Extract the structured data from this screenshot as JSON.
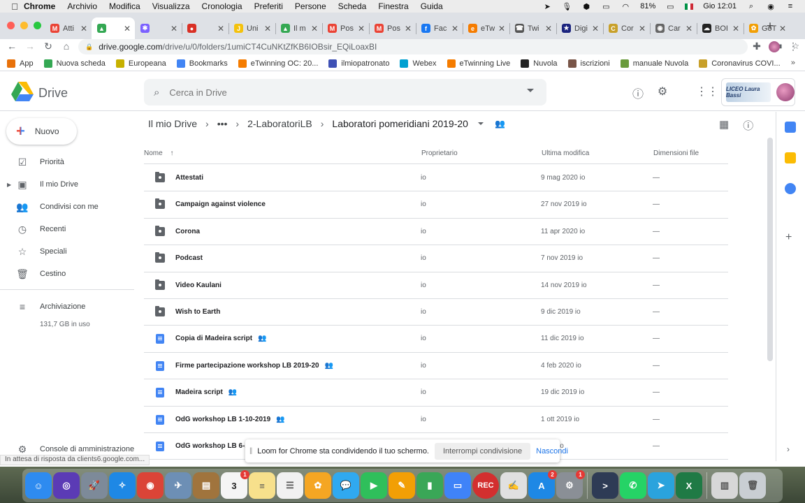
{
  "menubar": {
    "items": [
      "Chrome",
      "Archivio",
      "Modifica",
      "Visualizza",
      "Cronologia",
      "Preferiti",
      "Persone",
      "Scheda",
      "Finestra",
      "Guida"
    ],
    "battery": "81%",
    "clock": "Gio 12:01"
  },
  "tabs": [
    {
      "label": "Atti",
      "fav_color": "#ea4335",
      "fav": "M"
    },
    {
      "label": "",
      "fav_color": "#34a853",
      "fav": "▲",
      "active": true
    },
    {
      "label": "",
      "fav_color": "#7b61ff",
      "fav": "✱"
    },
    {
      "label": "",
      "fav_color": "#d93025",
      "fav": "●"
    },
    {
      "label": "Uni",
      "fav_color": "#f4c20d",
      "fav": "J"
    },
    {
      "label": "Il m",
      "fav_color": "#34a853",
      "fav": "▲"
    },
    {
      "label": "Pos",
      "fav_color": "#ea4335",
      "fav": "M"
    },
    {
      "label": "Pos",
      "fav_color": "#ea4335",
      "fav": "M"
    },
    {
      "label": "Fac",
      "fav_color": "#1877f2",
      "fav": "f"
    },
    {
      "label": "eTw",
      "fav_color": "#f57c00",
      "fav": "e"
    },
    {
      "label": "Twi",
      "fav_color": "#555555",
      "fav": "☎"
    },
    {
      "label": "Digi",
      "fav_color": "#1a237e",
      "fav": "★"
    },
    {
      "label": "Cor",
      "fav_color": "#c8a02a",
      "fav": "C"
    },
    {
      "label": "Car",
      "fav_color": "#666666",
      "fav": "◉"
    },
    {
      "label": "BOI",
      "fav_color": "#222222",
      "fav": "☁"
    },
    {
      "label": "GoT",
      "fav_color": "#f29f05",
      "fav": "✿"
    }
  ],
  "omnibox": {
    "host": "drive.google.com",
    "path": "/drive/u/0/folders/1umiCT4CuNKtZfKB6IOBsir_EQiLoaxBI"
  },
  "bookmarks": [
    {
      "label": "App",
      "color": "#e8710a"
    },
    {
      "label": "Nuova scheda",
      "color": "#34a853"
    },
    {
      "label": "Europeana",
      "color": "#c7b100"
    },
    {
      "label": "Bookmarks",
      "color": "#4285f4"
    },
    {
      "label": "eTwinning OC: 20...",
      "color": "#f57c00"
    },
    {
      "label": "ilmiopatronato",
      "color": "#3f51b5"
    },
    {
      "label": "Webex",
      "color": "#00a0d1"
    },
    {
      "label": "eTwinning Live",
      "color": "#f57c00"
    },
    {
      "label": "Nuvola",
      "color": "#222222"
    },
    {
      "label": "iscrizioni",
      "color": "#795548"
    },
    {
      "label": "manuale Nuvola",
      "color": "#6a9b3c"
    },
    {
      "label": "Coronavirus COVI...",
      "color": "#c8a02a"
    }
  ],
  "drive": {
    "title": "Drive",
    "search_placeholder": "Cerca in Drive",
    "account_label": "LICEO Laura Bassi"
  },
  "sidebar": {
    "new_label": "Nuovo",
    "items": [
      {
        "label": "Priorità",
        "icon": "check-icon",
        "glyph": "☑"
      },
      {
        "label": "Il mio Drive",
        "icon": "my-drive-icon",
        "glyph": "▣",
        "caret": true
      },
      {
        "label": "Condivisi con me",
        "icon": "shared-icon",
        "glyph": "👥"
      },
      {
        "label": "Recenti",
        "icon": "clock-icon",
        "glyph": "◷"
      },
      {
        "label": "Speciali",
        "icon": "star-icon",
        "glyph": "☆"
      },
      {
        "label": "Cestino",
        "icon": "trash-icon",
        "glyph": "🗑"
      }
    ],
    "storage_label": "Archiviazione",
    "storage_used": "131,7 GB in uso",
    "admin_label": "Console di amministrazione"
  },
  "breadcrumb": {
    "root": "Il mio Drive",
    "more": "•••",
    "parent": "2-LaboratoriLB",
    "current": "Laboratori pomeridiani 2019-20"
  },
  "table": {
    "col_name": "Nome",
    "col_owner": "Proprietario",
    "col_modified": "Ultima modifica",
    "col_size": "Dimensioni file",
    "rows": [
      {
        "name": "Attestati",
        "type": "folder",
        "owner": "io",
        "modified": "9 mag 2020 io",
        "size": "—",
        "shared": false
      },
      {
        "name": "Campaign against violence",
        "type": "folder",
        "owner": "io",
        "modified": "27 nov 2019 io",
        "size": "—",
        "shared": false
      },
      {
        "name": "Corona",
        "type": "folder",
        "owner": "io",
        "modified": "11 apr 2020 io",
        "size": "—",
        "shared": false
      },
      {
        "name": "Podcast",
        "type": "folder",
        "owner": "io",
        "modified": "7 nov 2019 io",
        "size": "—",
        "shared": false
      },
      {
        "name": "Video Kaulani",
        "type": "folder",
        "owner": "io",
        "modified": "14 nov 2019 io",
        "size": "—",
        "shared": false
      },
      {
        "name": "Wish to Earth",
        "type": "folder",
        "owner": "io",
        "modified": "9 dic 2019 io",
        "size": "—",
        "shared": false
      },
      {
        "name": "Copia di Madeira script",
        "type": "doc",
        "owner": "io",
        "modified": "11 dic 2019 io",
        "size": "—",
        "shared": true
      },
      {
        "name": "Firme partecipazione workshop LB 2019-20",
        "type": "doc",
        "owner": "io",
        "modified": "4 feb 2020 io",
        "size": "—",
        "shared": true
      },
      {
        "name": "Madeira script",
        "type": "doc",
        "owner": "io",
        "modified": "19 dic 2019 io",
        "size": "—",
        "shared": true
      },
      {
        "name": "OdG workshop LB 1-10-2019",
        "type": "doc",
        "owner": "io",
        "modified": "1 ott 2019 io",
        "size": "—",
        "shared": true
      },
      {
        "name": "OdG workshop LB 6-2",
        "type": "doc",
        "owner": "io",
        "modified": "2020 io",
        "size": "—",
        "shared": false
      }
    ]
  },
  "loom": {
    "message": "Loom for Chrome sta condividendo il tuo schermo.",
    "stop_label": "Interrompi condivisione",
    "hide_label": "Nascondi"
  },
  "statusbar": "In attesa di risposta da clients6.google.com...",
  "dock": [
    {
      "name": "finder-icon",
      "color": "#2e8bf0",
      "glyph": "☺"
    },
    {
      "name": "siri-icon",
      "color": "#5b3bb5",
      "glyph": "◎"
    },
    {
      "name": "launchpad-icon",
      "color": "#7d8a99",
      "glyph": "🚀"
    },
    {
      "name": "safari-icon",
      "color": "#1e88e5",
      "glyph": "✧"
    },
    {
      "name": "chrome-icon",
      "color": "#db4437",
      "glyph": "◉"
    },
    {
      "name": "preview-icon",
      "color": "#6d8fb5",
      "glyph": "✈"
    },
    {
      "name": "notefile-icon",
      "color": "#a0743d",
      "glyph": "▤"
    },
    {
      "name": "calendar-icon",
      "color": "#f5f5f5",
      "glyph": "3",
      "badge": "1",
      "text_color": "#222"
    },
    {
      "name": "notes-icon",
      "color": "#f7e08c",
      "glyph": "≡",
      "text_color": "#555"
    },
    {
      "name": "reminders-icon",
      "color": "#f1f1f1",
      "glyph": "☰",
      "text_color": "#555"
    },
    {
      "name": "photos-icon",
      "color": "#f5a623",
      "glyph": "✿"
    },
    {
      "name": "messages-icon",
      "color": "#30a9f0",
      "glyph": "💬"
    },
    {
      "name": "facetime-icon",
      "color": "#2fbf5b",
      "glyph": "▶"
    },
    {
      "name": "pages-icon",
      "color": "#f29f05",
      "glyph": "✎"
    },
    {
      "name": "numbers-icon",
      "color": "#3aa757",
      "glyph": "▮"
    },
    {
      "name": "keynote-icon",
      "color": "#3f83f8",
      "glyph": "▭"
    },
    {
      "name": "rec-icon",
      "color": "#d32f2f",
      "glyph": "REC"
    },
    {
      "name": "textedit-icon",
      "color": "#e0e0e0",
      "glyph": "✍",
      "text_color": "#333"
    },
    {
      "name": "appstore-icon",
      "color": "#1e88e5",
      "glyph": "A",
      "badge": "2"
    },
    {
      "name": "system-prefs-icon",
      "color": "#8a8f96",
      "glyph": "⚙",
      "badge": "1"
    },
    {
      "name": "teams-icon",
      "color": "#2e3b55",
      "glyph": ">"
    },
    {
      "name": "whatsapp-icon",
      "color": "#25d366",
      "glyph": "✆"
    },
    {
      "name": "telegram-icon",
      "color": "#2aa3dd",
      "glyph": "➤"
    },
    {
      "name": "excel-icon",
      "color": "#1f7a45",
      "glyph": "X"
    },
    {
      "name": "documents-icon",
      "color": "#d7d7d7",
      "glyph": "▥",
      "text_color": "#555"
    },
    {
      "name": "trash-icon",
      "color": "#c9ced3",
      "glyph": "🗑",
      "text_color": "#555"
    }
  ]
}
